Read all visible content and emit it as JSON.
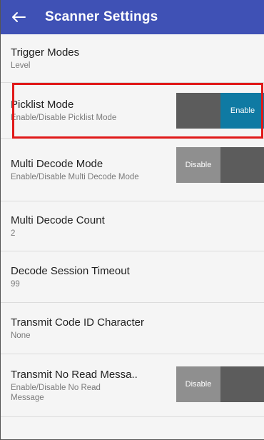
{
  "header": {
    "title": "Scanner Settings",
    "back_icon": "arrow-left-icon",
    "background": "#3f51b5"
  },
  "settings": [
    {
      "title": "Trigger Modes",
      "subtitle": "Level"
    },
    {
      "title": "Picklist Mode",
      "subtitle": "Enable/Disable Picklist Mode",
      "toggle_label": "Enable",
      "toggle_state": "on",
      "highlighted": true
    },
    {
      "title": "Multi Decode Mode",
      "subtitle": "Enable/Disable Multi Decode Mode",
      "toggle_label": "Disable",
      "toggle_state": "off"
    },
    {
      "title": "Multi Decode Count",
      "subtitle": "2"
    },
    {
      "title": "Decode Session Timeout",
      "subtitle": "99"
    },
    {
      "title": "Transmit Code ID Character",
      "subtitle": "None"
    },
    {
      "title": "Transmit No Read Messa..",
      "subtitle": "Enable/Disable No Read Message",
      "toggle_label": "Disable",
      "toggle_state": "off"
    }
  ],
  "colors": {
    "highlight": "#e01919",
    "toggle_enabled": "#0f7aa3",
    "toggle_disabled": "#8f8f8f",
    "toggle_track": "#5c5c5c"
  }
}
